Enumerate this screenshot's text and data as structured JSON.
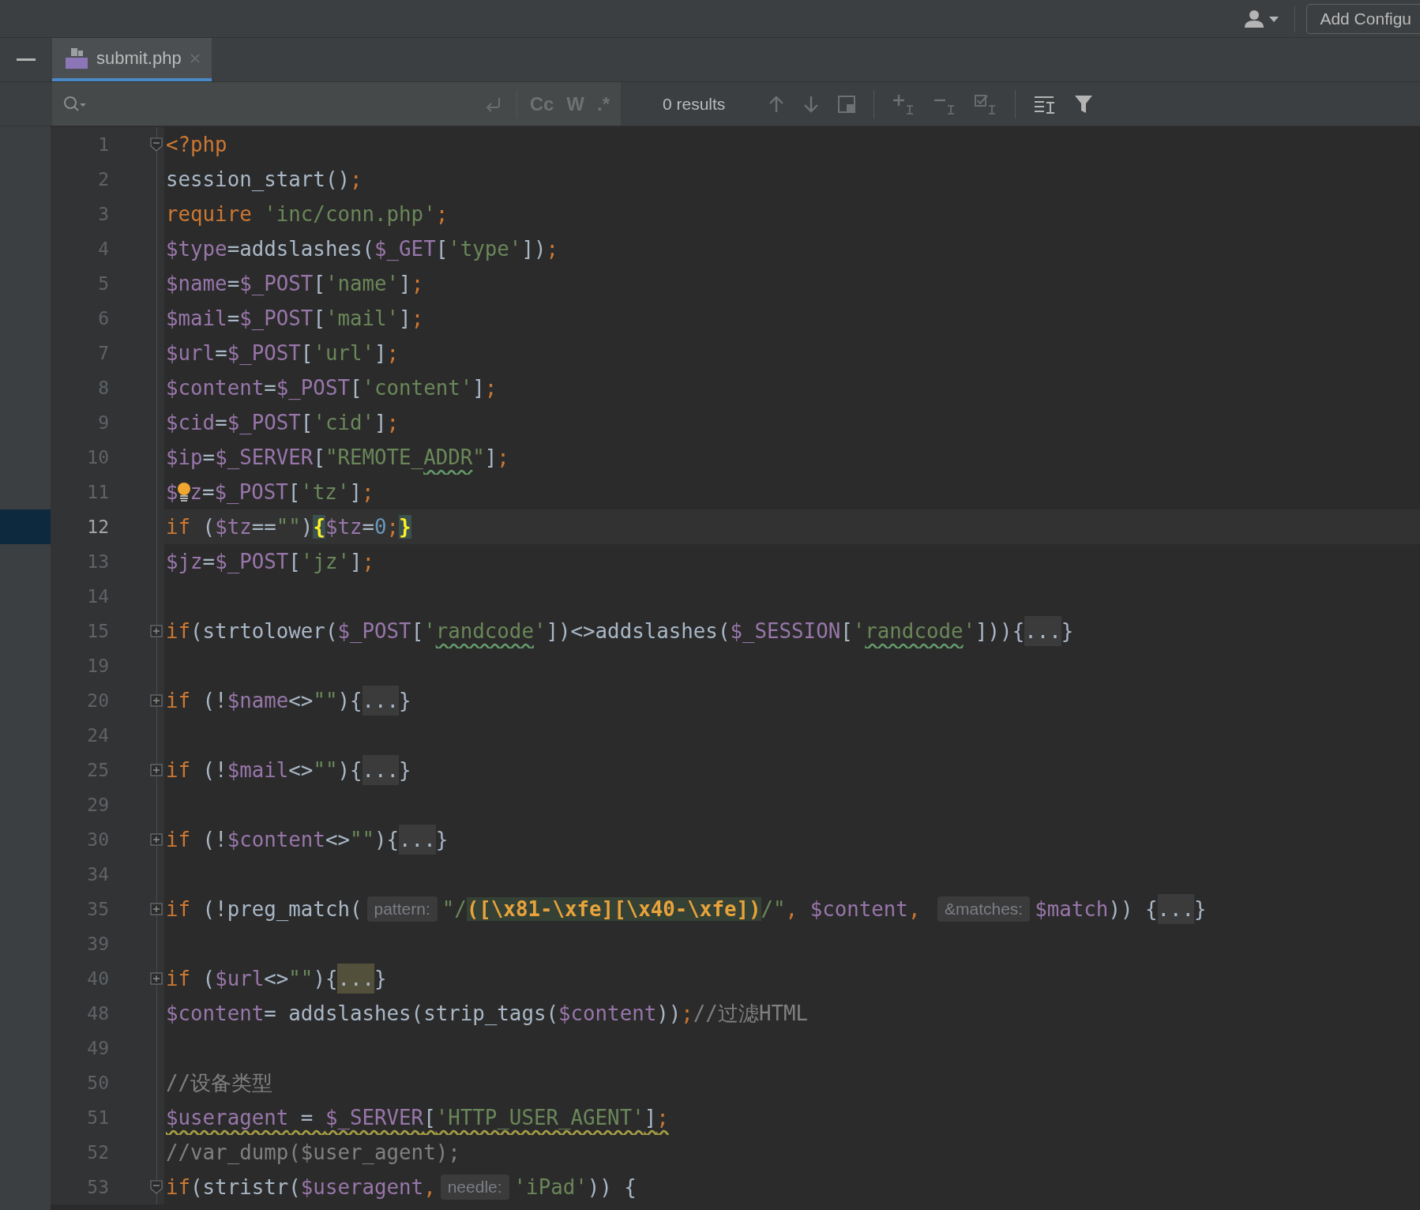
{
  "toolbar": {
    "config_button": "Add Configu"
  },
  "tabs": [
    {
      "title": "submit.php",
      "selected": true
    }
  ],
  "search": {
    "options": [
      "Cc",
      "W",
      ".*"
    ],
    "results": "0 results"
  },
  "lines": [
    {
      "number": "1",
      "fold_marker": true,
      "collapsed": false,
      "current": false,
      "segments": [
        {
          "text": "<?php",
          "kind": "kw"
        }
      ]
    },
    {
      "number": "2",
      "current": false,
      "segments": [
        {
          "text": "session_start()",
          "kind": "plain"
        },
        {
          "text": ";",
          "kind": "kw"
        }
      ]
    },
    {
      "number": "3",
      "current": false,
      "segments": [
        {
          "text": "require ",
          "kind": "kw"
        },
        {
          "text": "'inc/conn.php'",
          "kind": "str"
        },
        {
          "text": ";",
          "kind": "kw"
        }
      ]
    },
    {
      "number": "4",
      "current": false,
      "segments": [
        {
          "text": "$type",
          "kind": "var"
        },
        {
          "text": "=addslashes(",
          "kind": "plain"
        },
        {
          "text": "$_GET",
          "kind": "var"
        },
        {
          "text": "[",
          "kind": "plain"
        },
        {
          "text": "'type'",
          "kind": "str"
        },
        {
          "text": "])",
          "kind": "plain"
        },
        {
          "text": ";",
          "kind": "kw"
        }
      ]
    },
    {
      "number": "5",
      "current": false,
      "segments": [
        {
          "text": "$name",
          "kind": "var"
        },
        {
          "text": "=",
          "kind": "plain"
        },
        {
          "text": "$_POST",
          "kind": "var"
        },
        {
          "text": "[",
          "kind": "plain"
        },
        {
          "text": "'name'",
          "kind": "str"
        },
        {
          "text": "]",
          "kind": "plain"
        },
        {
          "text": ";",
          "kind": "kw"
        }
      ]
    },
    {
      "number": "6",
      "current": false,
      "segments": [
        {
          "text": "$mail",
          "kind": "var"
        },
        {
          "text": "=",
          "kind": "plain"
        },
        {
          "text": "$_POST",
          "kind": "var"
        },
        {
          "text": "[",
          "kind": "plain"
        },
        {
          "text": "'mail'",
          "kind": "str"
        },
        {
          "text": "]",
          "kind": "plain"
        },
        {
          "text": ";",
          "kind": "kw"
        }
      ]
    },
    {
      "number": "7",
      "current": false,
      "segments": [
        {
          "text": "$url",
          "kind": "var"
        },
        {
          "text": "=",
          "kind": "plain"
        },
        {
          "text": "$_POST",
          "kind": "var"
        },
        {
          "text": "[",
          "kind": "plain"
        },
        {
          "text": "'url'",
          "kind": "str"
        },
        {
          "text": "]",
          "kind": "plain"
        },
        {
          "text": ";",
          "kind": "kw"
        }
      ]
    },
    {
      "number": "8",
      "current": false,
      "segments": [
        {
          "text": "$content",
          "kind": "var"
        },
        {
          "text": "=",
          "kind": "plain"
        },
        {
          "text": "$_POST",
          "kind": "var"
        },
        {
          "text": "[",
          "kind": "plain"
        },
        {
          "text": "'content'",
          "kind": "str"
        },
        {
          "text": "]",
          "kind": "plain"
        },
        {
          "text": ";",
          "kind": "kw"
        }
      ]
    },
    {
      "number": "9",
      "current": false,
      "segments": [
        {
          "text": "$cid",
          "kind": "var"
        },
        {
          "text": "=",
          "kind": "plain"
        },
        {
          "text": "$_POST",
          "kind": "var"
        },
        {
          "text": "[",
          "kind": "plain"
        },
        {
          "text": "'cid'",
          "kind": "str"
        },
        {
          "text": "]",
          "kind": "plain"
        },
        {
          "text": ";",
          "kind": "kw"
        }
      ]
    },
    {
      "number": "10",
      "current": false,
      "segments": [
        {
          "text": "$ip",
          "kind": "var"
        },
        {
          "text": "=",
          "kind": "plain"
        },
        {
          "text": "$_SERVER",
          "kind": "var"
        },
        {
          "text": "[",
          "kind": "plain"
        },
        {
          "text": "\"REMOTE_",
          "kind": "str"
        },
        {
          "text": "ADDR",
          "kind": "str",
          "typo": true
        },
        {
          "text": "\"",
          "kind": "str"
        },
        {
          "text": "]",
          "kind": "plain"
        },
        {
          "text": ";",
          "kind": "kw"
        }
      ]
    },
    {
      "number": "11",
      "current": false,
      "segments": [
        {
          "text": "$",
          "kind": "var"
        },
        {
          "kind": "bulb"
        },
        {
          "text": "z",
          "kind": "var"
        },
        {
          "text": "=",
          "kind": "plain"
        },
        {
          "text": "$_POST",
          "kind": "var"
        },
        {
          "text": "[",
          "kind": "plain"
        },
        {
          "text": "'tz'",
          "kind": "str"
        },
        {
          "text": "]",
          "kind": "plain"
        },
        {
          "text": ";",
          "kind": "kw"
        }
      ]
    },
    {
      "number": "12",
      "current": true,
      "segments": [
        {
          "text": "if",
          "kind": "kw"
        },
        {
          "text": " (",
          "kind": "plain"
        },
        {
          "text": "$tz",
          "kind": "var"
        },
        {
          "text": "==",
          "kind": "plain"
        },
        {
          "text": "\"\"",
          "kind": "str"
        },
        {
          "text": ")",
          "kind": "plain"
        },
        {
          "text": "{",
          "kind": "brace"
        },
        {
          "text": "$tz",
          "kind": "var"
        },
        {
          "text": "=",
          "kind": "plain"
        },
        {
          "text": "0",
          "kind": "num"
        },
        {
          "text": ";",
          "kind": "kw"
        },
        {
          "text": "}",
          "kind": "brace"
        }
      ]
    },
    {
      "number": "13",
      "current": false,
      "segments": [
        {
          "text": "$jz",
          "kind": "var"
        },
        {
          "text": "=",
          "kind": "plain"
        },
        {
          "text": "$_POST",
          "kind": "var"
        },
        {
          "text": "[",
          "kind": "plain"
        },
        {
          "text": "'jz'",
          "kind": "str"
        },
        {
          "text": "]",
          "kind": "plain"
        },
        {
          "text": ";",
          "kind": "kw"
        }
      ]
    },
    {
      "number": "14",
      "current": false
    },
    {
      "number": "15",
      "fold_marker": true,
      "collapsed": true,
      "current": false,
      "segments": [
        {
          "text": "if",
          "kind": "kw"
        },
        {
          "text": "(strtolower(",
          "kind": "plain"
        },
        {
          "text": "$_POST",
          "kind": "var"
        },
        {
          "text": "[",
          "kind": "plain"
        },
        {
          "text": "'",
          "kind": "str"
        },
        {
          "text": "randcode",
          "kind": "str",
          "typo": true
        },
        {
          "text": "'",
          "kind": "str"
        },
        {
          "text": "])<>addslashes(",
          "kind": "plain"
        },
        {
          "text": "$_SESSION",
          "kind": "var"
        },
        {
          "text": "[",
          "kind": "plain"
        },
        {
          "text": "'",
          "kind": "str"
        },
        {
          "text": "randcode",
          "kind": "str",
          "typo": true
        },
        {
          "text": "'",
          "kind": "str"
        },
        {
          "text": "])){",
          "kind": "plain"
        },
        {
          "text": "...",
          "kind": "fold"
        },
        {
          "text": "}",
          "kind": "plain"
        }
      ]
    },
    {
      "number": "19",
      "current": false
    },
    {
      "number": "20",
      "fold_marker": true,
      "collapsed": true,
      "current": false,
      "segments": [
        {
          "text": "if",
          "kind": "kw"
        },
        {
          "text": " (!",
          "kind": "plain"
        },
        {
          "text": "$name",
          "kind": "var"
        },
        {
          "text": "<>",
          "kind": "plain"
        },
        {
          "text": "\"\"",
          "kind": "str"
        },
        {
          "text": "){",
          "kind": "plain"
        },
        {
          "text": "...",
          "kind": "fold"
        },
        {
          "text": "}",
          "kind": "plain"
        }
      ]
    },
    {
      "number": "24",
      "current": false
    },
    {
      "number": "25",
      "fold_marker": true,
      "collapsed": true,
      "current": false,
      "segments": [
        {
          "text": "if",
          "kind": "kw"
        },
        {
          "text": " (!",
          "kind": "plain"
        },
        {
          "text": "$mail",
          "kind": "var"
        },
        {
          "text": "<>",
          "kind": "plain"
        },
        {
          "text": "\"\"",
          "kind": "str"
        },
        {
          "text": "){",
          "kind": "plain"
        },
        {
          "text": "...",
          "kind": "fold"
        },
        {
          "text": "}",
          "kind": "plain"
        }
      ]
    },
    {
      "number": "29",
      "current": false
    },
    {
      "number": "30",
      "fold_marker": true,
      "collapsed": true,
      "current": false,
      "segments": [
        {
          "text": "if",
          "kind": "kw"
        },
        {
          "text": " (!",
          "kind": "plain"
        },
        {
          "text": "$content",
          "kind": "var"
        },
        {
          "text": "<>",
          "kind": "plain"
        },
        {
          "text": "\"\"",
          "kind": "str"
        },
        {
          "text": "){",
          "kind": "plain"
        },
        {
          "text": "...",
          "kind": "fold"
        },
        {
          "text": "}",
          "kind": "plain"
        }
      ]
    },
    {
      "number": "34",
      "current": false
    },
    {
      "number": "35",
      "fold_marker": true,
      "collapsed": true,
      "current": false,
      "segments": [
        {
          "text": "if",
          "kind": "kw"
        },
        {
          "text": " (!preg_match(",
          "kind": "plain"
        },
        {
          "text": "pattern:",
          "kind": "hint"
        },
        {
          "text": "\"/",
          "kind": "str"
        },
        {
          "text": "([\\x81-\\xfe][\\x40-\\xfe])",
          "kind": "regex"
        },
        {
          "text": "/\"",
          "kind": "str"
        },
        {
          "text": ", ",
          "kind": "kw"
        },
        {
          "text": "$content",
          "kind": "var"
        },
        {
          "text": ", ",
          "kind": "kw"
        },
        {
          "text": "&matches:",
          "kind": "hint"
        },
        {
          "text": "$match",
          "kind": "var"
        },
        {
          "text": ")) {",
          "kind": "plain"
        },
        {
          "text": "...",
          "kind": "fold"
        },
        {
          "text": "}",
          "kind": "plain"
        }
      ]
    },
    {
      "number": "39",
      "current": false
    },
    {
      "number": "40",
      "fold_marker": true,
      "collapsed": true,
      "current": false,
      "segments": [
        {
          "text": "if",
          "kind": "kw"
        },
        {
          "text": " (",
          "kind": "plain"
        },
        {
          "text": "$url",
          "kind": "var"
        },
        {
          "text": "<>",
          "kind": "plain"
        },
        {
          "text": "\"\"",
          "kind": "str"
        },
        {
          "text": "){",
          "kind": "plain"
        },
        {
          "text": "...",
          "kind": "foldmark"
        },
        {
          "text": "}",
          "kind": "plain"
        }
      ]
    },
    {
      "number": "48",
      "current": false,
      "segments": [
        {
          "text": "$content",
          "kind": "var"
        },
        {
          "text": "= addslashes(strip_tags(",
          "kind": "plain"
        },
        {
          "text": "$content",
          "kind": "var"
        },
        {
          "text": "))",
          "kind": "plain"
        },
        {
          "text": ";",
          "kind": "kw"
        },
        {
          "text": "//过滤HTML",
          "kind": "cmt"
        }
      ]
    },
    {
      "number": "49",
      "current": false
    },
    {
      "number": "50",
      "current": false,
      "segments": [
        {
          "text": "//设备类型",
          "kind": "cmt"
        }
      ]
    },
    {
      "number": "51",
      "current": false,
      "warning": true,
      "segments": [
        {
          "text": "$useragent",
          "kind": "var"
        },
        {
          "text": " = ",
          "kind": "plain"
        },
        {
          "text": "$_SERVER",
          "kind": "var"
        },
        {
          "text": "[",
          "kind": "plain"
        },
        {
          "text": "'HTTP_USER_AGENT'",
          "kind": "str"
        },
        {
          "text": "]",
          "kind": "plain"
        },
        {
          "text": ";",
          "kind": "kw"
        }
      ]
    },
    {
      "number": "52",
      "current": false,
      "segments": [
        {
          "text": "//var_dump($user_agent);",
          "kind": "cmt"
        }
      ]
    },
    {
      "number": "53",
      "fold_marker": true,
      "collapsed": false,
      "current": false,
      "segments": [
        {
          "text": "if",
          "kind": "kw"
        },
        {
          "text": "(stristr(",
          "kind": "plain"
        },
        {
          "text": "$useragent",
          "kind": "var"
        },
        {
          "text": ",",
          "kind": "kw"
        },
        {
          "text": "needle:",
          "kind": "hint"
        },
        {
          "text": "'iPad'",
          "kind": "str"
        },
        {
          "text": ")) {",
          "kind": "plain"
        }
      ]
    }
  ]
}
